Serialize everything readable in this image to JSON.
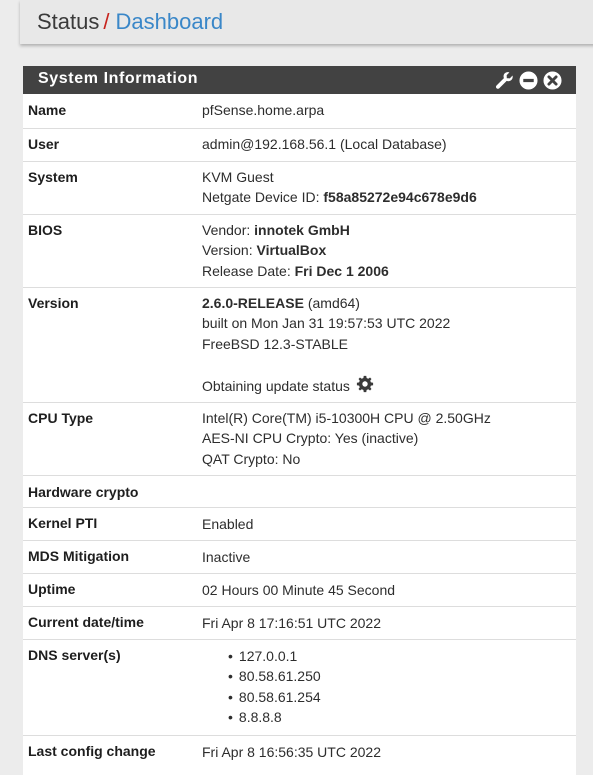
{
  "breadcrumb": {
    "root": "Status",
    "separator": "/",
    "current": "Dashboard"
  },
  "panel": {
    "title": "System Information",
    "icons": [
      "wrench-icon",
      "minimize-icon",
      "close-icon"
    ],
    "header_color": "#424242"
  },
  "info": {
    "name": {
      "label": "Name",
      "value": "pfSense.home.arpa"
    },
    "user": {
      "label": "User",
      "value": "admin@192.168.56.1 (Local Database)"
    },
    "system": {
      "label": "System",
      "line1": "KVM Guest",
      "device_id_prefix": "Netgate Device ID: ",
      "device_id": "f58a85272e94c678e9d6"
    },
    "bios": {
      "label": "BIOS",
      "vendor_prefix": "Vendor: ",
      "vendor": "innotek GmbH",
      "version_prefix": "Version: ",
      "version": "VirtualBox",
      "release_prefix": "Release Date: ",
      "release": "Fri Dec 1 2006"
    },
    "version": {
      "label": "Version",
      "release": "2.6.0-RELEASE",
      "arch": " (amd64)",
      "built": "built on Mon Jan 31 19:57:53 UTC 2022",
      "os": "FreeBSD 12.3-STABLE",
      "update_status": "Obtaining update status"
    },
    "cpu": {
      "label": "CPU Type",
      "model": "Intel(R) Core(TM) i5-10300H CPU @ 2.50GHz",
      "aesni": "AES-NI CPU Crypto: Yes (inactive)",
      "qat": "QAT Crypto: No"
    },
    "hw_crypto": {
      "label": "Hardware crypto",
      "value": ""
    },
    "kernel_pti": {
      "label": "Kernel PTI",
      "value": "Enabled"
    },
    "mds": {
      "label": "MDS Mitigation",
      "value": "Inactive"
    },
    "uptime": {
      "label": "Uptime",
      "value": "02 Hours 00 Minute 45 Second"
    },
    "datetime": {
      "label": "Current date/time",
      "value": "Fri Apr 8 17:16:51 UTC 2022"
    },
    "dns": {
      "label": "DNS server(s)",
      "servers": [
        "127.0.0.1",
        "80.58.61.250",
        "80.58.61.254",
        "8.8.8.8"
      ]
    },
    "last_config": {
      "label": "Last config change",
      "value": "Fri Apr 8 16:56:35 UTC 2022"
    }
  }
}
